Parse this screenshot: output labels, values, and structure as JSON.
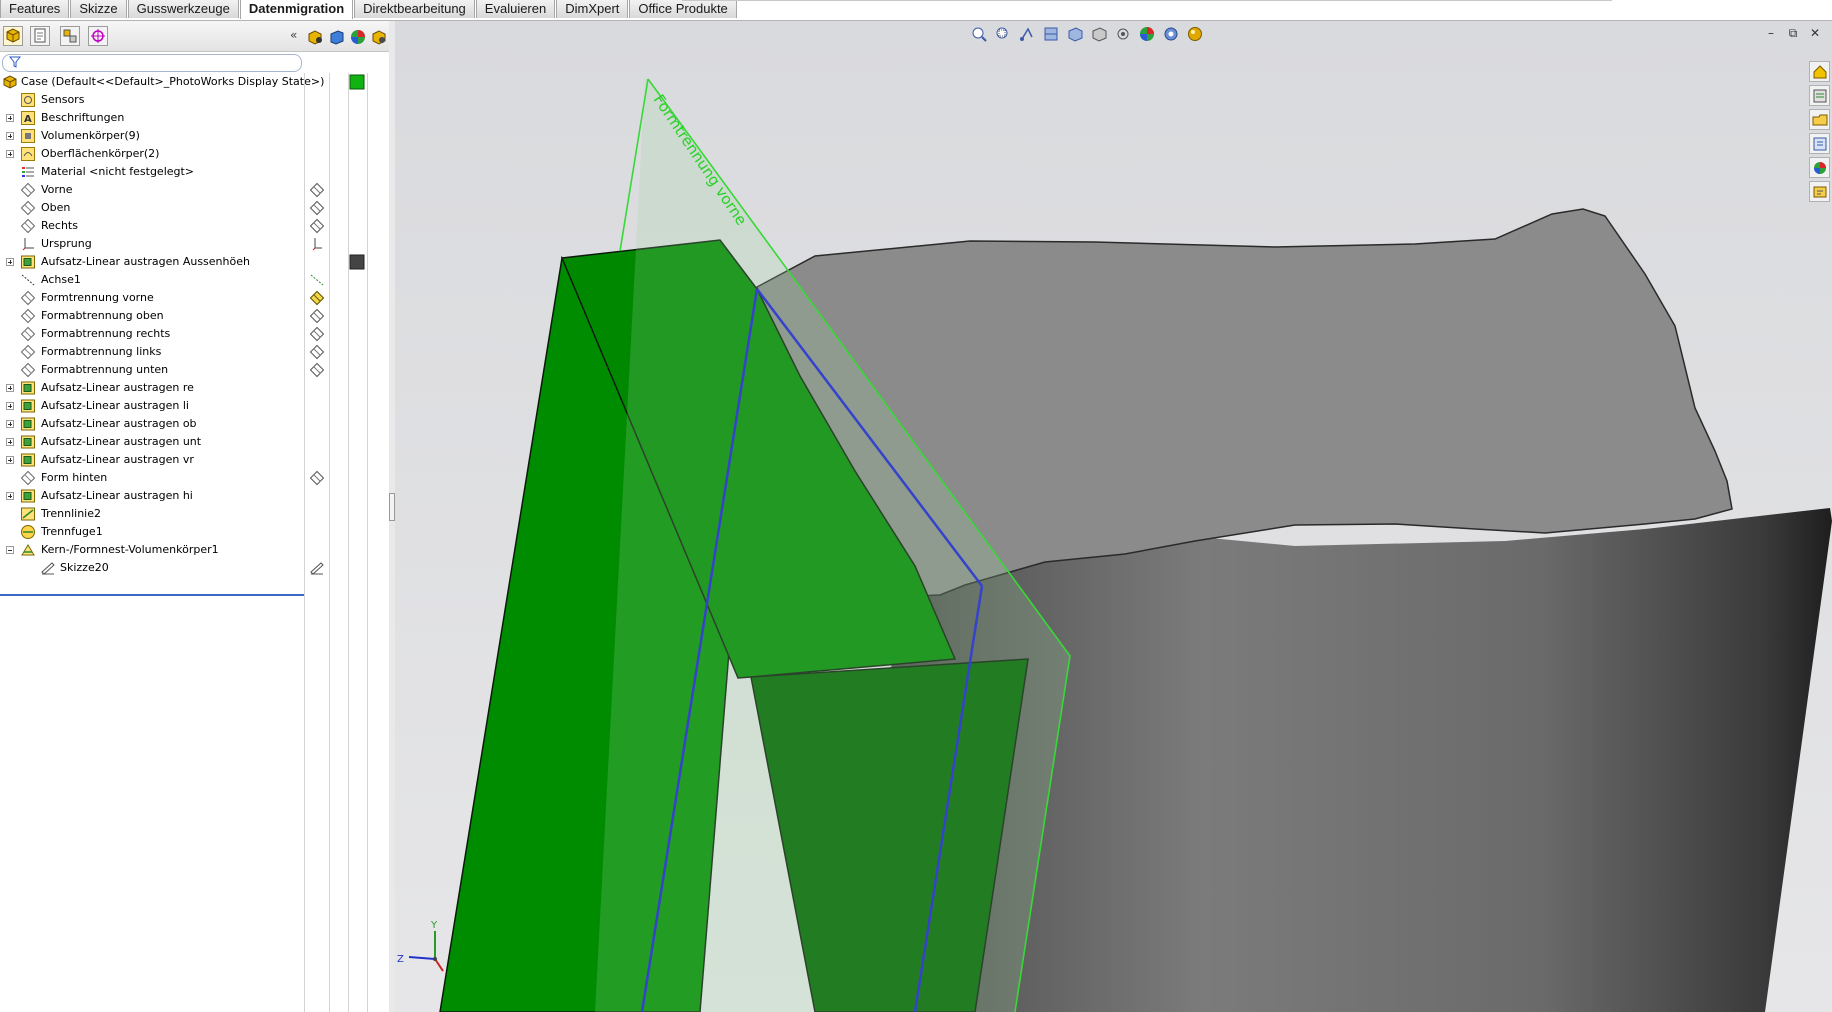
{
  "tabs": [
    {
      "label": "Features",
      "active": false
    },
    {
      "label": "Skizze",
      "active": false
    },
    {
      "label": "Gusswerkzeuge",
      "active": false
    },
    {
      "label": "Datenmigration",
      "active": true
    },
    {
      "label": "Direktbearbeitung",
      "active": false
    },
    {
      "label": "Evaluieren",
      "active": false
    },
    {
      "label": "DimXpert",
      "active": false
    },
    {
      "label": "Office Produkte",
      "active": false
    }
  ],
  "panel_tabs": [
    "featuremanager-icon",
    "propertymanager-icon",
    "configurationmanager-icon",
    "dimxpert-manager-icon"
  ],
  "panel_columns": [
    "hide-show-icon",
    "body-icon",
    "appearance-icon",
    "display-state-icon"
  ],
  "tree": {
    "root": {
      "label": "Case  (Default<<Default>_PhotoWorks Display State>)",
      "icon": "part-icon"
    },
    "items": [
      {
        "label": "Sensors",
        "icon": "sensor-icon",
        "expander": false
      },
      {
        "label": "Beschriftungen",
        "icon": "annotation-icon",
        "expander": "plus"
      },
      {
        "label": "Volumenkörper(9)",
        "icon": "solid-bodies-icon",
        "expander": "plus"
      },
      {
        "label": "Oberflächenkörper(2)",
        "icon": "surface-bodies-icon",
        "expander": "plus"
      },
      {
        "label": "Material <nicht festgelegt>",
        "icon": "material-icon",
        "expander": false
      },
      {
        "label": "Vorne",
        "icon": "plane-icon",
        "expander": false
      },
      {
        "label": "Oben",
        "icon": "plane-icon",
        "expander": false
      },
      {
        "label": "Rechts",
        "icon": "plane-icon",
        "expander": false
      },
      {
        "label": "Ursprung",
        "icon": "origin-icon",
        "expander": false
      },
      {
        "label": "Aufsatz-Linear austragen Aussenhöeh",
        "icon": "extrude-icon",
        "expander": "plus"
      },
      {
        "label": "Achse1",
        "icon": "axis-icon",
        "expander": false
      },
      {
        "label": "Formtrennung vorne",
        "icon": "plane-icon",
        "expander": false
      },
      {
        "label": "Formabtrennung oben",
        "icon": "plane-icon",
        "expander": false
      },
      {
        "label": "Formabtrennung rechts",
        "icon": "plane-icon",
        "expander": false
      },
      {
        "label": "Formabtrennung links",
        "icon": "plane-icon",
        "expander": false
      },
      {
        "label": "Formabtrennung unten",
        "icon": "plane-icon",
        "expander": false
      },
      {
        "label": "Aufsatz-Linear austragen re",
        "icon": "extrude-icon",
        "expander": "plus"
      },
      {
        "label": "Aufsatz-Linear austragen li",
        "icon": "extrude-icon",
        "expander": "plus"
      },
      {
        "label": "Aufsatz-Linear austragen ob",
        "icon": "extrude-icon",
        "expander": "plus"
      },
      {
        "label": "Aufsatz-Linear austragen unt",
        "icon": "extrude-icon",
        "expander": "plus"
      },
      {
        "label": "Aufsatz-Linear austragen vr",
        "icon": "extrude-icon",
        "expander": "plus"
      },
      {
        "label": "Form hinten",
        "icon": "plane-icon",
        "expander": false
      },
      {
        "label": "Aufsatz-Linear austragen hi",
        "icon": "extrude-icon",
        "expander": "plus"
      },
      {
        "label": "Trennlinie2",
        "icon": "parting-line-icon",
        "expander": false
      },
      {
        "label": "Trennfuge1",
        "icon": "parting-surface-icon",
        "expander": false
      },
      {
        "label": "Kern-/Formnest-Volumenkörper1",
        "icon": "tooling-split-icon",
        "expander": "minus"
      },
      {
        "label": "Skizze20",
        "icon": "sketch-icon",
        "expander": false,
        "indent": true
      }
    ]
  },
  "viewport": {
    "plane_label": "Formtrennung vorne",
    "triad": {
      "y": "Y",
      "z": "Z"
    },
    "heads_up_icons": [
      "zoom-to-fit-icon",
      "zoom-to-area-icon",
      "previous-view-icon",
      "section-view-icon",
      "view-orientation-icon",
      "display-style-icon",
      "hide-show-items-icon",
      "edit-appearance-icon",
      "apply-scene-icon",
      "view-settings-icon"
    ],
    "window_controls": {
      "minimize": "–",
      "restore": "⧉",
      "close": "✕"
    },
    "taskpane_icons": [
      "sw-resources-icon",
      "design-library-icon",
      "file-explorer-icon",
      "view-palette-icon",
      "appearances-icon",
      "custom-properties-icon"
    ],
    "colors": {
      "green_face": "#008a00",
      "green_dark": "#006300",
      "gray_top": "#8a8a8a",
      "blue_edge": "#1b1bd6",
      "plane_edge": "#3ddf3d"
    }
  }
}
